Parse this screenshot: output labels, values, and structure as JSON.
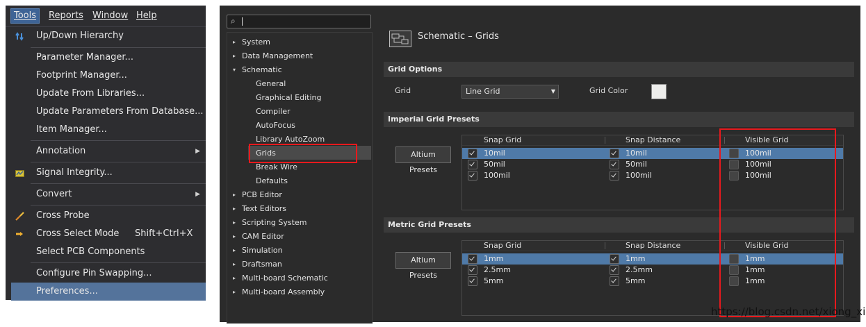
{
  "menubar": {
    "items": [
      "Tools",
      "Reports",
      "Window",
      "Help"
    ]
  },
  "tools_menu": {
    "items": [
      {
        "label": "Up/Down Hierarchy",
        "icon": "hierarchy-arrows-icon"
      },
      {
        "label": "Parameter Manager..."
      },
      {
        "label": "Footprint Manager..."
      },
      {
        "label": "Update From Libraries..."
      },
      {
        "label": "Update Parameters From Database..."
      },
      {
        "label": "Item Manager..."
      },
      {
        "label": "Annotation",
        "submenu": true
      },
      {
        "label": "Signal Integrity...",
        "icon": "signal-integrity-icon"
      },
      {
        "label": "Convert",
        "submenu": true
      },
      {
        "label": "Cross Probe",
        "icon": "cross-probe-icon"
      },
      {
        "label": "Cross Select Mode",
        "shortcut": "Shift+Ctrl+X",
        "icon": "cross-select-icon"
      },
      {
        "label": "Select PCB Components"
      },
      {
        "label": "Configure Pin Swapping..."
      },
      {
        "label": "Preferences...",
        "highlighted": true
      }
    ]
  },
  "tree": {
    "nodes": [
      {
        "label": "System",
        "level": 0,
        "expander": "▸"
      },
      {
        "label": "Data Management",
        "level": 0,
        "expander": "▸"
      },
      {
        "label": "Schematic",
        "level": 0,
        "expander": "▾"
      },
      {
        "label": "General",
        "level": 1
      },
      {
        "label": "Graphical Editing",
        "level": 1
      },
      {
        "label": "Compiler",
        "level": 1
      },
      {
        "label": "AutoFocus",
        "level": 1
      },
      {
        "label": "Library AutoZoom",
        "level": 1
      },
      {
        "label": "Grids",
        "level": 1,
        "selected": true
      },
      {
        "label": "Break Wire",
        "level": 1
      },
      {
        "label": "Defaults",
        "level": 1
      },
      {
        "label": "PCB Editor",
        "level": 0,
        "expander": "▸"
      },
      {
        "label": "Text Editors",
        "level": 0,
        "expander": "▸"
      },
      {
        "label": "Scripting System",
        "level": 0,
        "expander": "▸"
      },
      {
        "label": "CAM Editor",
        "level": 0,
        "expander": "▸"
      },
      {
        "label": "Simulation",
        "level": 0,
        "expander": "▸"
      },
      {
        "label": "Draftsman",
        "level": 0,
        "expander": "▸"
      },
      {
        "label": "Multi-board Schematic",
        "level": 0,
        "expander": "▸"
      },
      {
        "label": "Multi-board Assembly",
        "level": 0,
        "expander": "▸"
      }
    ]
  },
  "page": {
    "title": "Schematic – Grids"
  },
  "grid_options": {
    "heading": "Grid Options",
    "grid_label": "Grid",
    "grid_value": "Line Grid",
    "grid_color_label": "Grid Color",
    "grid_color": "#eeeeec"
  },
  "imperial": {
    "heading": "Imperial Grid Presets",
    "button": "Altium Presets",
    "columns": [
      "Snap Grid",
      "Snap Distance",
      "Visible Grid"
    ],
    "rows": [
      {
        "snap": "10mil",
        "distance": "10mil",
        "visible": "100mil",
        "selected": true
      },
      {
        "snap": "50mil",
        "distance": "50mil",
        "visible": "100mil"
      },
      {
        "snap": "100mil",
        "distance": "100mil",
        "visible": "100mil"
      }
    ]
  },
  "metric": {
    "heading": "Metric Grid Presets",
    "button": "Altium Presets",
    "columns": [
      "Snap Grid",
      "Snap Distance",
      "Visible Grid"
    ],
    "rows": [
      {
        "snap": "1mm",
        "distance": "1mm",
        "visible": "1mm",
        "selected": true
      },
      {
        "snap": "2.5mm",
        "distance": "2.5mm",
        "visible": "1mm"
      },
      {
        "snap": "5mm",
        "distance": "5mm",
        "visible": "1mm"
      }
    ]
  },
  "colors": {
    "highlight_red": "#e8191d",
    "selection_blue": "#4f7aa8",
    "menu_highlight": "#54739b"
  },
  "watermark": "https://blog.csdn.net/xiong_xin"
}
